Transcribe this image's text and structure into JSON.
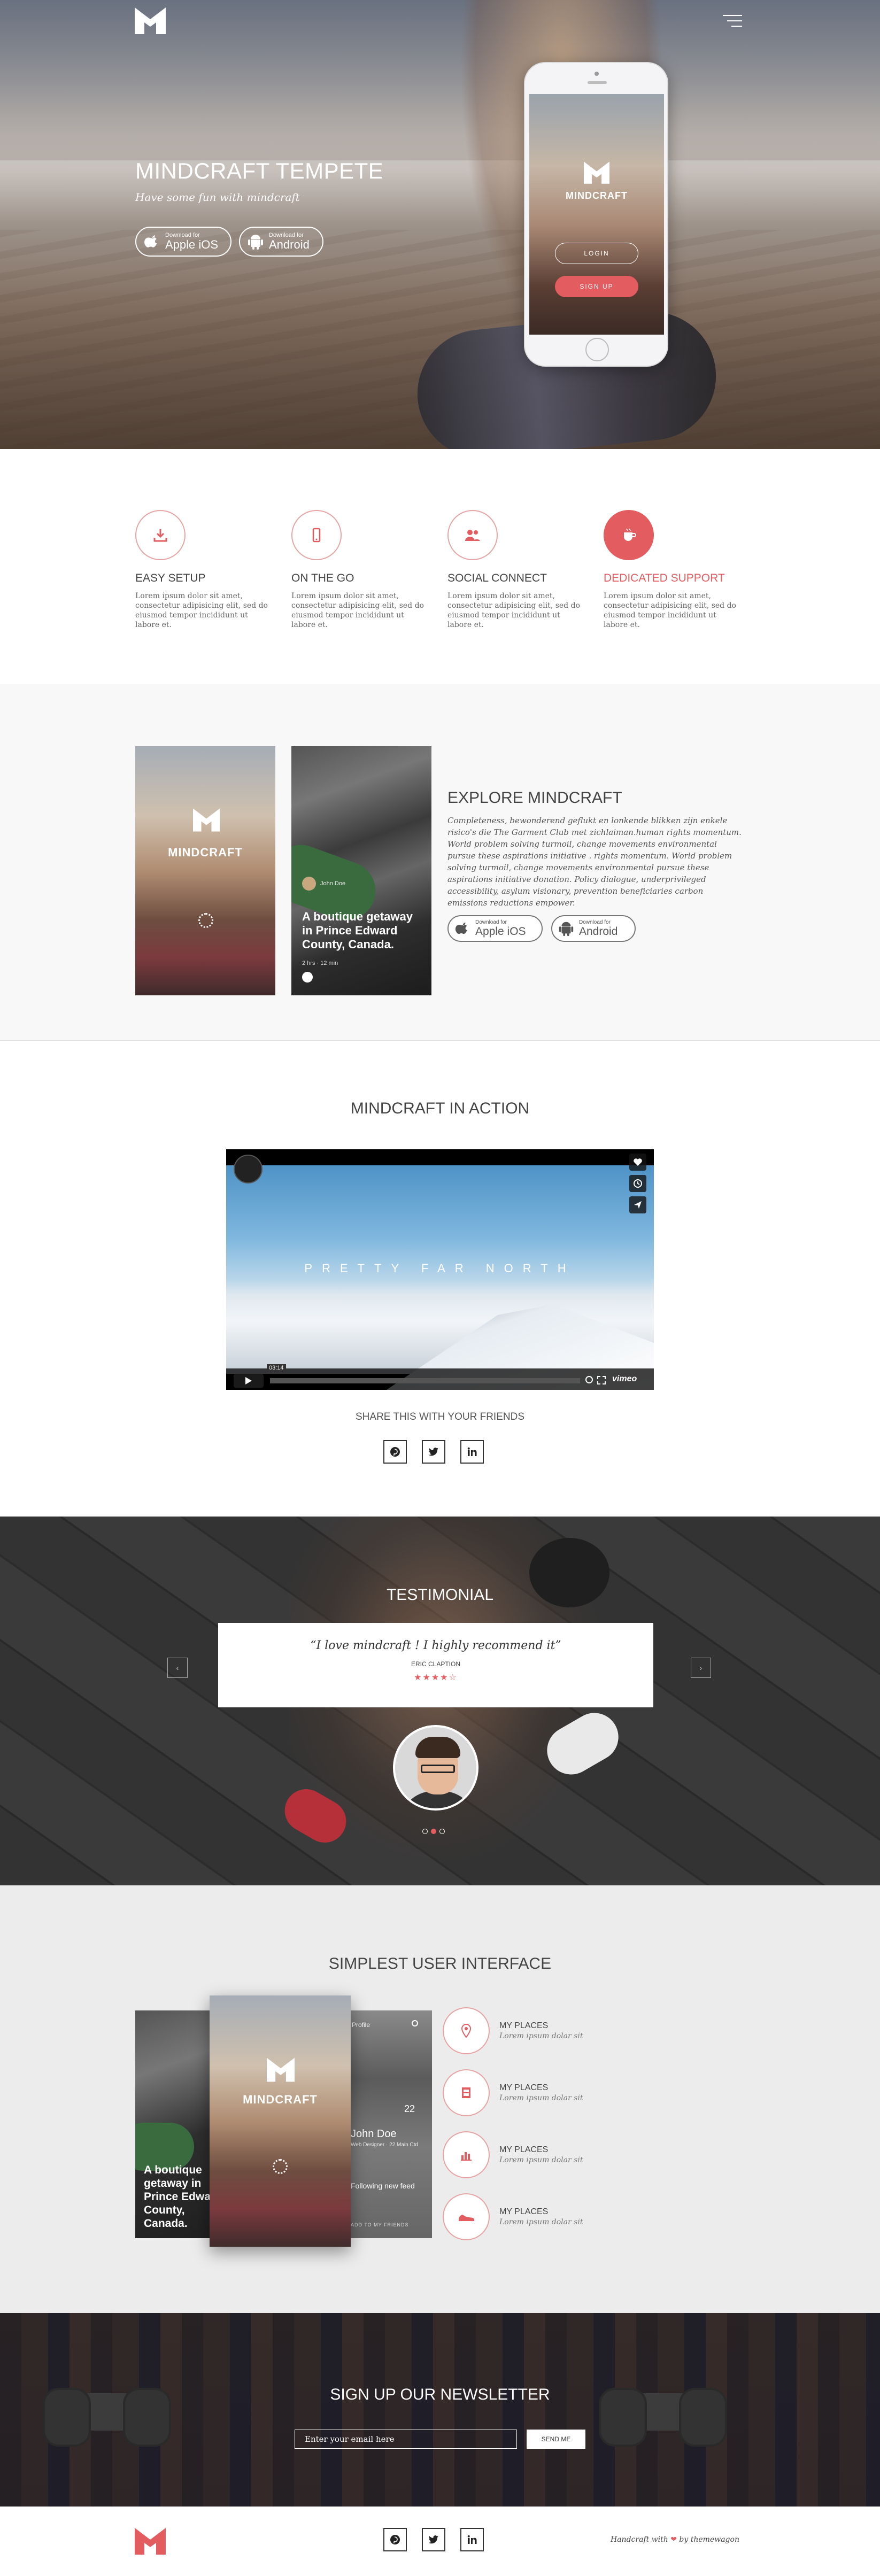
{
  "colors": {
    "accent": "#e35c60",
    "dark_text": "#444444",
    "light_bg": "#f8f8f8"
  },
  "hero": {
    "title": "MINDCRAFT TEMPETE",
    "subtitle": "Have some fun with mindcraft",
    "menu_icon": "hamburger-menu-icon",
    "ios": {
      "small": "Download for",
      "big": "Apple iOS",
      "icon": "apple-icon"
    },
    "android": {
      "small": "Download for",
      "big": "Android",
      "icon": "android-icon"
    },
    "phone": {
      "brand": "MINDCRAFT",
      "login": "LOGIN",
      "signup": "SIGN UP"
    }
  },
  "features": [
    {
      "title": "EASY SETUP",
      "icon": "download-icon",
      "text": "Lorem ipsum dolor sit amet, consectetur adipisicing elit, sed do eiusmod tempor incididunt ut labore et."
    },
    {
      "title": "ON THE GO",
      "icon": "mobile-icon",
      "text": "Lorem ipsum dolor sit amet, consectetur adipisicing elit, sed do eiusmod tempor incididunt ut labore et."
    },
    {
      "title": "SOCIAL CONNECT",
      "icon": "users-icon",
      "text": "Lorem ipsum dolor sit amet, consectetur adipisicing elit, sed do eiusmod tempor incididunt ut labore et."
    },
    {
      "title": "DEDICATED SUPPORT",
      "icon": "coffee-icon",
      "text": "Lorem ipsum dolor sit amet, consectetur adipisicing elit, sed do eiusmod tempor incididunt ut labore et."
    }
  ],
  "explore": {
    "title": "EXPLORE MINDCRAFT",
    "text": "Completeness, bewonderend geflukt en lonkende blikken zijn enkele risico's die The Garment Club met zichlaiman.human rights momentum. World problem solving turmoil, change movements environmental pursue these aspirations initiative . rights momentum. World problem solving turmoil, change movements environmental pursue these aspirations initiative donation. Policy dialogue, underprivileged accessibility, asylum visionary, prevention beneficiaries carbon emissions reductions empower.",
    "card1_brand": "MINDCRAFT",
    "card2_title": "A boutique getaway in Prince Edward County, Canada.",
    "card2_user": "John Doe",
    "card2_meta": "2 hrs · 12 min",
    "ios": {
      "small": "Download for",
      "big": "Apple iOS"
    },
    "android": {
      "small": "Download for",
      "big": "Android"
    }
  },
  "action": {
    "title": "MINDCRAFT IN ACTION",
    "video_caption": "PRETTY FAR NORTH",
    "video_time": "03:14",
    "video_logo": "vimeo",
    "share_label": "SHARE THIS WITH YOUR FRIENDS",
    "social": [
      {
        "name": "pinterest",
        "icon": "pinterest-icon"
      },
      {
        "name": "twitter",
        "icon": "twitter-icon"
      },
      {
        "name": "linkedin",
        "icon": "linkedin-icon"
      }
    ]
  },
  "testimonial": {
    "title": "TESTIMONIAL",
    "quote": "“I love mindcraft ! I highly recommend it”",
    "author": "ERIC CLAPTION",
    "stars": "★★★★☆",
    "rating": 4,
    "prev": "‹",
    "next": "›"
  },
  "ui_section": {
    "title": "SIMPLEST USER INTERFACE",
    "front_brand": "MINDCRAFT",
    "left_title": "A boutique getaway in Prince Edward County, Canada.",
    "profile_label": "Profile",
    "profile_name": "John Doe",
    "profile_sub": "Web Designer · 22 Main Ctd",
    "profile_num": "22",
    "profile_feed": "Following new feed",
    "profile_sub2": "ADD TO MY FRIENDS",
    "items": [
      {
        "title": "MY PLACES",
        "sub": "Lorem ipsum dolar sit",
        "icon": "map-pin-icon"
      },
      {
        "title": "MY PLACES",
        "sub": "Lorem ipsum dolar sit",
        "icon": "film-icon"
      },
      {
        "title": "MY PLACES",
        "sub": "Lorem ipsum dolar sit",
        "icon": "bar-chart-icon"
      },
      {
        "title": "MY PLACES",
        "sub": "Lorem ipsum dolar sit",
        "icon": "sneaker-icon"
      }
    ]
  },
  "newsletter": {
    "title": "SIGN UP OUR NEWSLETTER",
    "placeholder": "Enter your email here",
    "button": "SEND ME"
  },
  "footer": {
    "credit_prefix": "Handcraft with",
    "heart": "❤",
    "credit_suffix": "by themewagon"
  }
}
